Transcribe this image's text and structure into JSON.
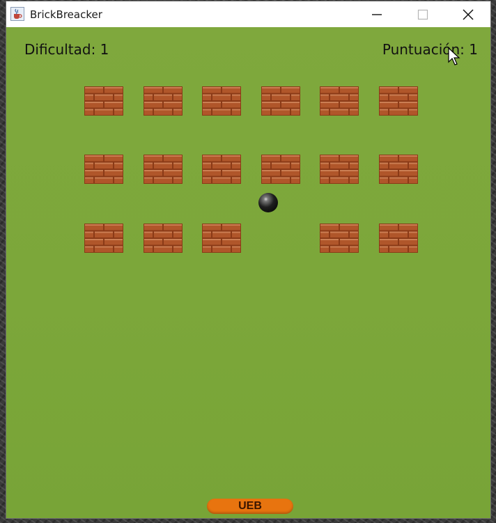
{
  "window": {
    "title": "BrickBreacker",
    "app_icon": "java-cup-icon",
    "controls": [
      "minimize-icon",
      "maximize-icon",
      "close-icon"
    ]
  },
  "hud": {
    "difficulty_label": "Dificultad: 1",
    "score_label": "Puntuación: 1"
  },
  "bricks": {
    "rows": [
      [
        true,
        true,
        true,
        true,
        true,
        true
      ],
      [
        true,
        true,
        true,
        true,
        true,
        true
      ],
      [
        true,
        true,
        true,
        false,
        true,
        true
      ]
    ],
    "color": "#b0562a",
    "mortar_color": "#8a3a17"
  },
  "paddle": {
    "label": "UEB",
    "color": "#e8740f"
  },
  "colors": {
    "field": "#7ca73a",
    "ball": "#000000"
  }
}
